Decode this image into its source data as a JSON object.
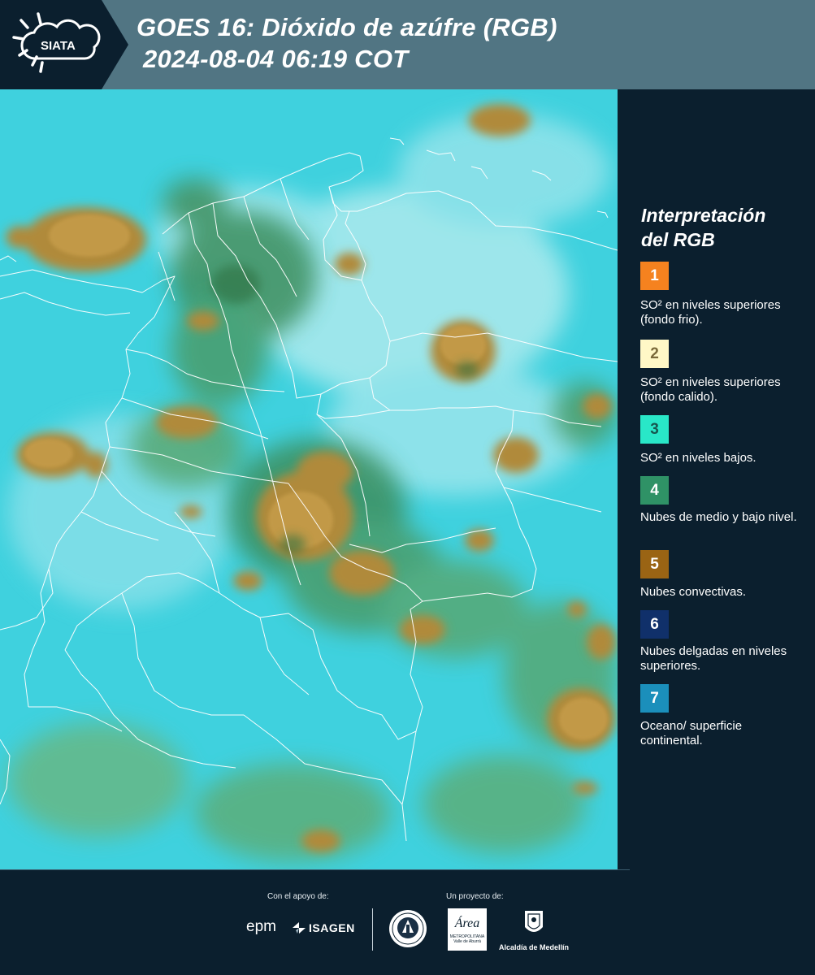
{
  "header": {
    "logo_text": "SIATA",
    "title_line1": "GOES 16: Dióxido de azúfre (RGB)",
    "title_line2": "2024-08-04 06:19 COT"
  },
  "legend": {
    "title_line1": "Interpretación",
    "title_line2": "del RGB",
    "items": [
      {
        "number": "1",
        "color": "#f5821f",
        "text_color": "#ffffff",
        "label": "SO² en niveles superiores (fondo frio)."
      },
      {
        "number": "2",
        "color": "#fff8c6",
        "text_color": "#7a6a3a",
        "label": "SO² en niveles superiores (fondo calido)."
      },
      {
        "number": "3",
        "color": "#29e7c8",
        "text_color": "#17564f",
        "label": "SO² en niveles bajos."
      },
      {
        "number": "4",
        "color": "#2f9266",
        "text_color": "#ffffff",
        "label": "Nubes de medio y bajo nivel."
      },
      {
        "number": "5",
        "color": "#9a6414",
        "text_color": "#ffffff",
        "label": "Nubes convectivas."
      },
      {
        "number": "6",
        "color": "#10306a",
        "text_color": "#ffffff",
        "label": "Nubes delgadas en niveles superiores."
      },
      {
        "number": "7",
        "color": "#1b8fbb",
        "text_color": "#ffffff",
        "label": "Oceano/ superficie continental."
      }
    ]
  },
  "footer": {
    "support_caption": "Con el apoyo de:",
    "project_caption": "Un proyecto de:",
    "epm_logo_text": "epm",
    "isagen_logo_text": "ISAGEN",
    "metropolitana_logo_text": "Área",
    "metropolitana_sub1": "METROPOLITANA",
    "metropolitana_sub2": "Valle de Aburrá",
    "medellin_logo_text": "Alcaldía de Medellín"
  },
  "map": {
    "background_color": "#3fd1de",
    "cloud_color": "#b08a3a",
    "vegetation_color": "#3e8f5e",
    "border_color": "#ffffff"
  }
}
